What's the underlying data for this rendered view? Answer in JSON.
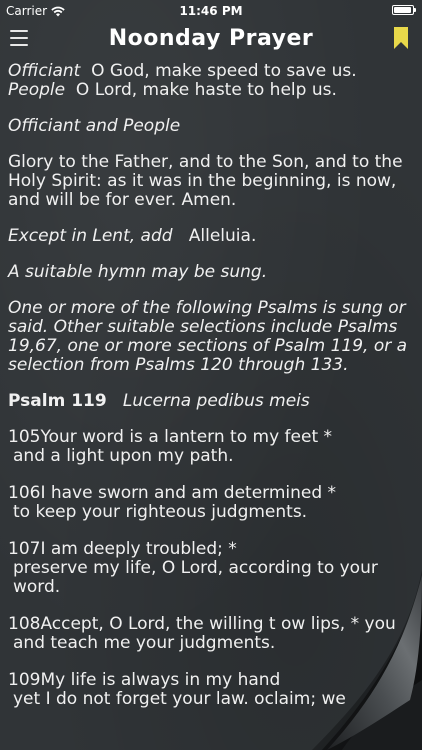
{
  "status_bar": {
    "carrier": "Carrier",
    "time": "11:46 PM",
    "battery_level": 0.95
  },
  "nav": {
    "title": "Noonday Prayer",
    "menu_icon": "hamburger-menu-icon",
    "bookmark_icon": "bookmark-icon",
    "bookmark_color": "#e8d84a"
  },
  "content": {
    "p1": {
      "role_officiant": "Officiant",
      "officiant_text": "O God, make speed to save us.",
      "role_people": "People",
      "people_text": "O Lord, make haste to help us."
    },
    "p2": "Officiant and People",
    "p3": "Glory to the Father, and to the Son, and to the Holy Spirit: as it was in the beginning, is now, and will be for ever.  Amen.",
    "p4": {
      "rubric": "Except in Lent, add",
      "text": "Alleluia."
    },
    "p5": "A suitable hymn may be sung.",
    "p6": "One or more of the following Psalms is sung or said.  Other suitable selections include Psalms 19,67, one or more sections of Psalm 119, or a selection from Psalms 120 through 133.",
    "psalm": {
      "title": "Psalm 119",
      "subtitle": "Lucerna pedibus meis"
    },
    "verses": [
      {
        "line1": "105Your word is a lantern to my feet *",
        "line2": "and a light upon my path."
      },
      {
        "line1": "106I have sworn and am determined *",
        "line2": "to keep your righteous judgments."
      },
      {
        "line1": "107I am deeply troubled; *",
        "line2": "preserve my life, O Lord, according to your word."
      },
      {
        "line1": "108Accept, O Lord, the willing t",
        "line1b": "ow lips, *",
        "line1c": "you",
        "line2": "and teach me your judgments."
      },
      {
        "line1": "109My life is always in my hand",
        "line2": "yet I do not forget your law.",
        "line2b": "oclaim; we"
      }
    ]
  }
}
